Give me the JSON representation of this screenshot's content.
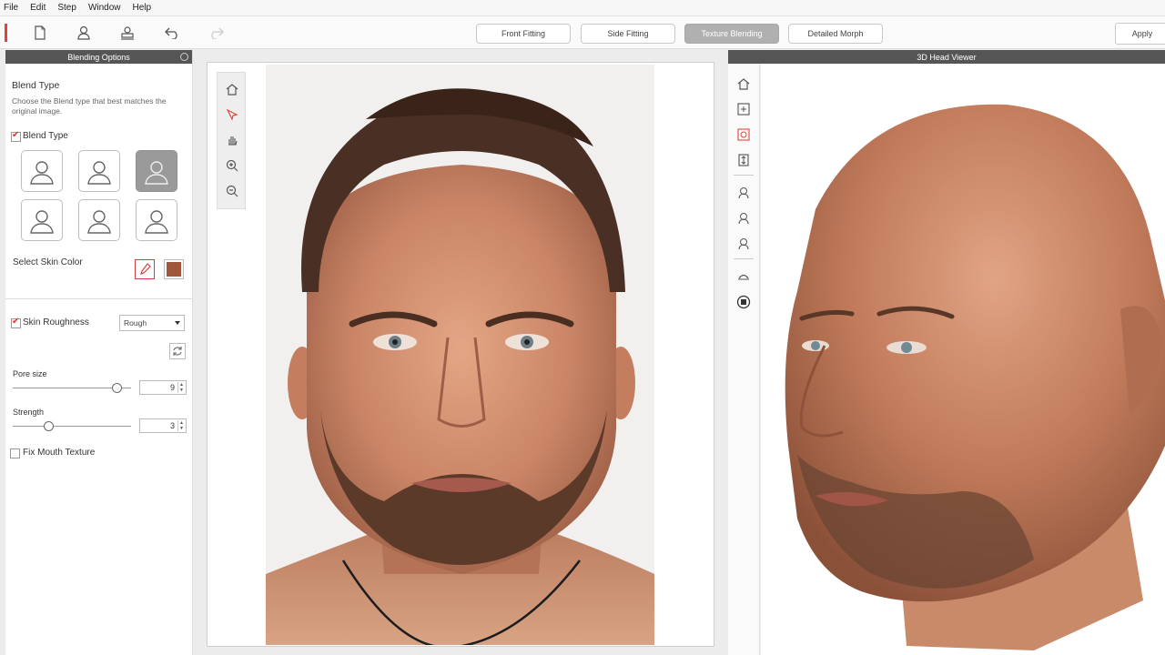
{
  "menu": [
    "File",
    "Edit",
    "Step",
    "Window",
    "Help"
  ],
  "toolbar": {
    "icons": [
      "new-file-icon",
      "user-icon",
      "stamp-icon",
      "undo-icon",
      "redo-icon"
    ],
    "steps": [
      {
        "label": "Front Fitting",
        "active": false
      },
      {
        "label": "Side Fitting",
        "active": false
      },
      {
        "label": "Texture Blending",
        "active": true
      },
      {
        "label": "Detailed Morph",
        "active": false
      }
    ],
    "apply_label": "Apply"
  },
  "left_panel": {
    "title": "Blending Options",
    "blend_type_heading": "Blend Type",
    "blend_type_desc": "Choose the Blend type that best matches the original image.",
    "blend_type_check_label": "Blend Type",
    "blend_type_checked": true,
    "blend_type_selected_index": 2,
    "select_skin_color_label": "Select Skin Color",
    "skin_color": "#a0583c",
    "skin_roughness_label": "Skin Roughness",
    "skin_roughness_checked": true,
    "roughness_value": "Rough",
    "pore_size_label": "Pore size",
    "pore_size_value": "9",
    "pore_size_fraction": 0.88,
    "strength_label": "Strength",
    "strength_value": "3",
    "strength_fraction": 0.3,
    "fix_mouth_label": "Fix Mouth Texture",
    "fix_mouth_checked": false
  },
  "center_tools": [
    "home-icon",
    "pointer-icon",
    "hand-icon",
    "zoom-in-icon",
    "zoom-out-icon"
  ],
  "right_viewer": {
    "title": "3D Head Viewer",
    "tools": [
      "home-icon",
      "fit-icon",
      "wireframe-icon",
      "vertical-fit-icon",
      "head-front-icon",
      "head-side-icon",
      "head-back-icon",
      "hair-icon",
      "target-icon"
    ]
  },
  "colors": {
    "accent": "#e0413a",
    "header_bg": "#555555"
  }
}
